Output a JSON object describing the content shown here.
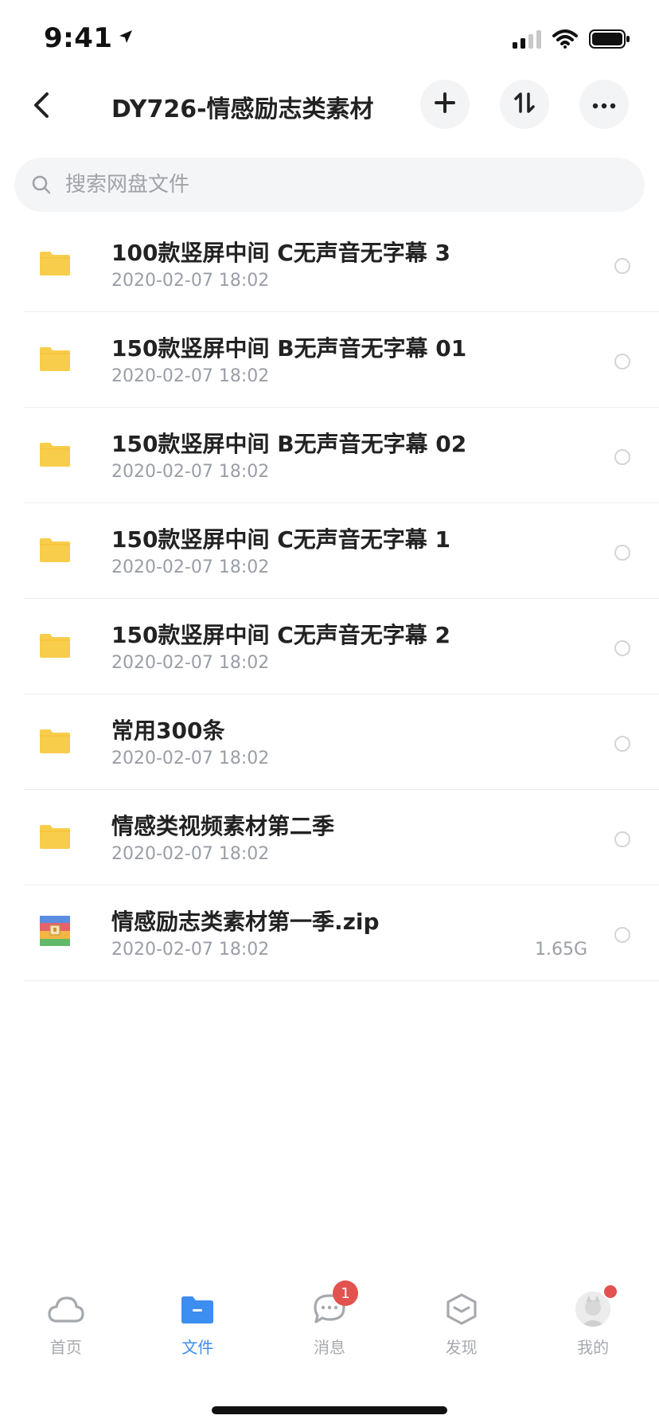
{
  "status_bar": {
    "time": "9:41"
  },
  "nav": {
    "title": "DY726-情感励志类素材"
  },
  "search": {
    "placeholder": "搜索网盘文件"
  },
  "files": [
    {
      "name": "100款竖屏中间 C无声音无字幕 3",
      "date": "2020-02-07 18:02",
      "size": "",
      "type": "folder"
    },
    {
      "name": "150款竖屏中间 B无声音无字幕 01",
      "date": "2020-02-07 18:02",
      "size": "",
      "type": "folder"
    },
    {
      "name": "150款竖屏中间 B无声音无字幕 02",
      "date": "2020-02-07 18:02",
      "size": "",
      "type": "folder"
    },
    {
      "name": "150款竖屏中间 C无声音无字幕 1",
      "date": "2020-02-07 18:02",
      "size": "",
      "type": "folder"
    },
    {
      "name": "150款竖屏中间 C无声音无字幕 2",
      "date": "2020-02-07 18:02",
      "size": "",
      "type": "folder"
    },
    {
      "name": "常用300条",
      "date": "2020-02-07 18:02",
      "size": "",
      "type": "folder"
    },
    {
      "name": "情感类视频素材第二季",
      "date": "2020-02-07 18:02",
      "size": "",
      "type": "folder"
    },
    {
      "name": "情感励志类素材第一季.zip",
      "date": "2020-02-07 18:02",
      "size": "1.65G",
      "type": "zip"
    }
  ],
  "tabs": [
    {
      "label": "首页",
      "icon": "cloud-icon"
    },
    {
      "label": "文件",
      "icon": "folder-icon"
    },
    {
      "label": "消息",
      "icon": "chat-bubble-icon",
      "badge": "1"
    },
    {
      "label": "发现",
      "icon": "cube-icon"
    },
    {
      "label": "我的",
      "icon": "avatar"
    }
  ],
  "colors": {
    "accent": "#3c8ef0",
    "folder": "#f8cd4c",
    "badge": "#e2524f",
    "muted_text": "#9a9ea6"
  }
}
